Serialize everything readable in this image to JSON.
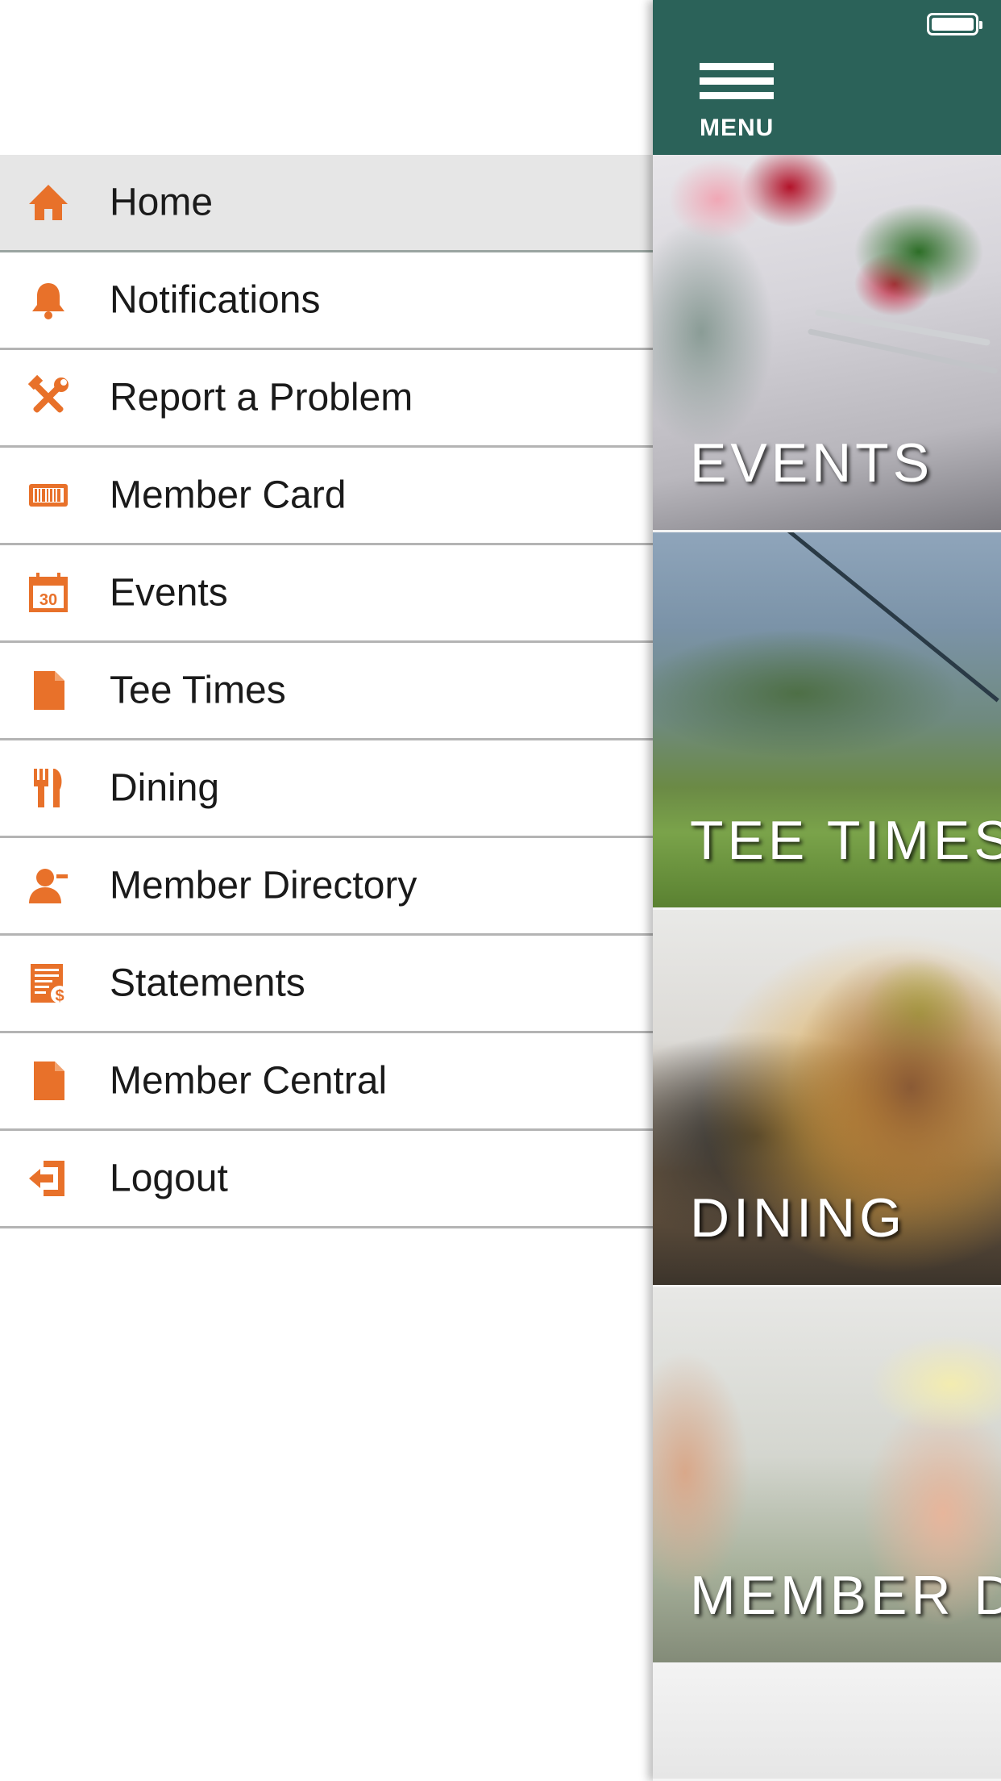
{
  "drawer": {
    "items": [
      {
        "label": "Home",
        "icon": "home-icon",
        "active": true
      },
      {
        "label": "Notifications",
        "icon": "bell-icon"
      },
      {
        "label": "Report a Problem",
        "icon": "tools-icon"
      },
      {
        "label": "Member Card",
        "icon": "barcode-icon"
      },
      {
        "label": "Events",
        "icon": "calendar-icon",
        "icon_text": "30"
      },
      {
        "label": "Tee Times",
        "icon": "document-icon"
      },
      {
        "label": "Dining",
        "icon": "fork-knife-icon"
      },
      {
        "label": "Member Directory",
        "icon": "person-icon"
      },
      {
        "label": "Statements",
        "icon": "statement-icon"
      },
      {
        "label": "Member Central",
        "icon": "document-icon"
      },
      {
        "label": "Logout",
        "icon": "logout-icon"
      }
    ]
  },
  "header": {
    "menu_label": "MENU"
  },
  "tiles": [
    {
      "label": "EVENTS"
    },
    {
      "label": "TEE TIMES"
    },
    {
      "label": "DINING"
    },
    {
      "label": "MEMBER D"
    }
  ],
  "colors": {
    "accent": "#e8712a",
    "header_bg": "#2b6259",
    "active_row_bg": "#e6e6e6"
  }
}
